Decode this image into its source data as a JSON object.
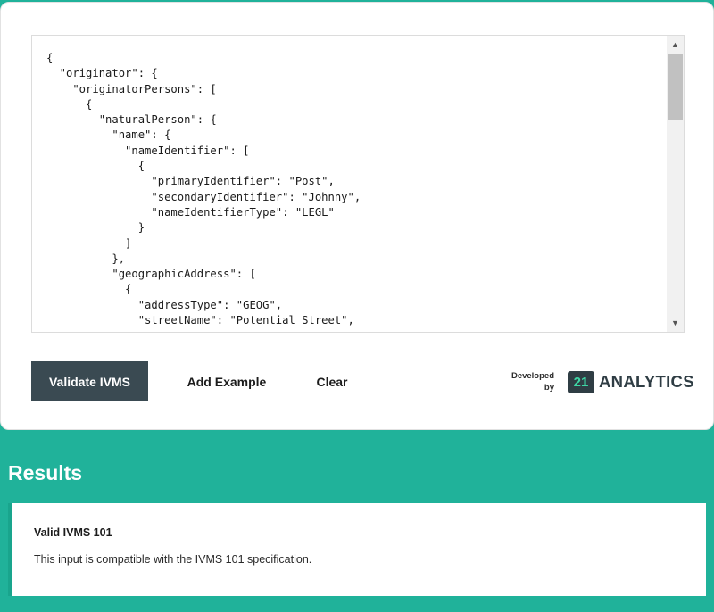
{
  "editor": {
    "content": "{\n  \"originator\": {\n    \"originatorPersons\": [\n      {\n        \"naturalPerson\": {\n          \"name\": {\n            \"nameIdentifier\": [\n              {\n                \"primaryIdentifier\": \"Post\",\n                \"secondaryIdentifier\": \"Johnny\",\n                \"nameIdentifierType\": \"LEGL\"\n              }\n            ]\n          },\n          \"geographicAddress\": [\n            {\n              \"addressType\": \"GEOG\",\n              \"streetName\": \"Potential Street\","
  },
  "actions": {
    "validate_label": "Validate IVMS",
    "example_label": "Add Example",
    "clear_label": "Clear"
  },
  "branding": {
    "developed_line1": "Developed",
    "developed_line2": "by",
    "logo_mark": "21",
    "logo_word": "ANALYTICS"
  },
  "results": {
    "title": "Results",
    "status_title": "Valid IVMS 101",
    "status_message": "This input is compatible with the IVMS 101 specification."
  },
  "colors": {
    "background": "#20b29a",
    "primary_button": "#3a4a52",
    "logo_accent": "#3ed6a5"
  }
}
